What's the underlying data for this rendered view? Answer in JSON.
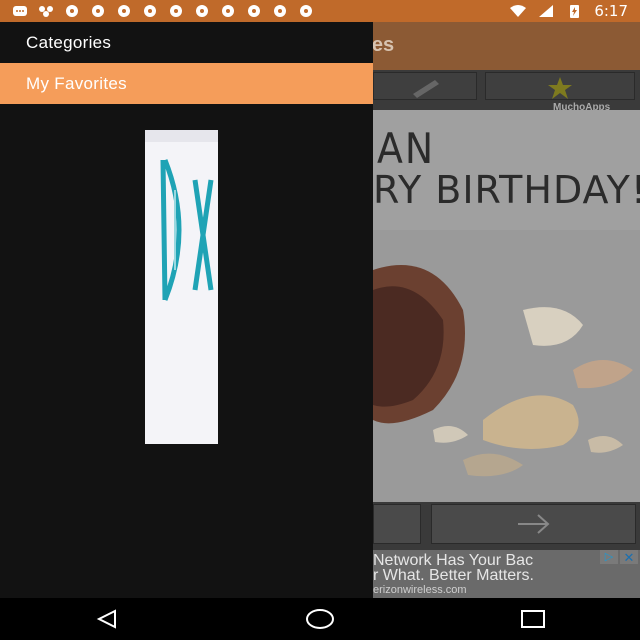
{
  "status_bar": {
    "time": "6:17",
    "icons": [
      "message-icon",
      "share-icon",
      "soccer-ball-icon",
      "soccer-ball-icon",
      "soccer-ball-icon",
      "soccer-ball-icon",
      "soccer-ball-icon",
      "soccer-ball-icon",
      "soccer-ball-icon",
      "soccer-ball-icon",
      "soccer-ball-icon",
      "soccer-ball-icon",
      "wifi-icon",
      "signal-icon",
      "battery-icon"
    ]
  },
  "app": {
    "title_fragment": "otes",
    "brand": "MuchoApps",
    "card": {
      "line1": "AN",
      "line2": "RY BIRTHDAY!"
    },
    "ad": {
      "line1": "Network Has Your Bac",
      "line2": "r What. Better Matters.",
      "line3": "erizonwireless.com",
      "close": "✕",
      "play": "▷"
    }
  },
  "drawer": {
    "items": [
      {
        "label": "Categories",
        "active": false
      },
      {
        "label": "My Favorites",
        "active": true
      }
    ],
    "accent_color": "#f59d5a"
  },
  "system_nav": {
    "buttons": [
      "back-icon",
      "home-icon",
      "recents-icon"
    ]
  }
}
